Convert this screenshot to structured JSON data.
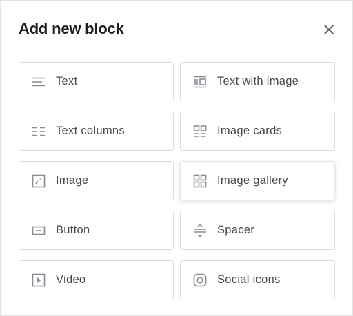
{
  "dialog": {
    "title": "Add new block",
    "close_icon": "close-icon"
  },
  "blocks": [
    {
      "label": "Text",
      "icon": "text-icon"
    },
    {
      "label": "Text with image",
      "icon": "text-with-image-icon"
    },
    {
      "label": "Text columns",
      "icon": "text-columns-icon"
    },
    {
      "label": "Image cards",
      "icon": "image-cards-icon"
    },
    {
      "label": "Image",
      "icon": "image-icon"
    },
    {
      "label": "Image gallery",
      "icon": "image-gallery-icon"
    },
    {
      "label": "Button",
      "icon": "button-icon"
    },
    {
      "label": "Spacer",
      "icon": "spacer-icon"
    },
    {
      "label": "Video",
      "icon": "video-icon"
    },
    {
      "label": "Social icons",
      "icon": "social-icons-icon"
    }
  ],
  "colors": {
    "text": "#47474e",
    "icon": "#8a8a93",
    "border": "#dcdce0",
    "title": "#1f1f23"
  }
}
